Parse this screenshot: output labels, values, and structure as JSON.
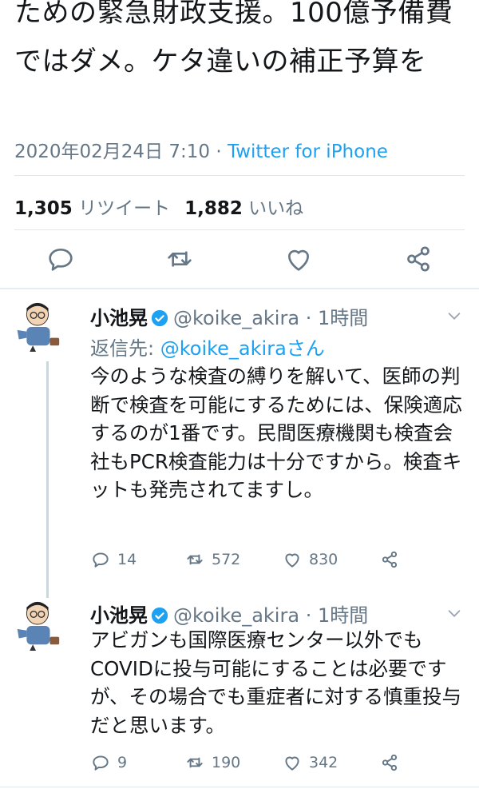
{
  "tweet": {
    "text": "ための緊急財政支援。100億予備費ではダメ。ケタ違いの補正予算を",
    "datetime": "2020年02月24日 7:10",
    "separator": " · ",
    "source": "Twitter for iPhone",
    "retweets": {
      "count": "1,305",
      "label": "リツイート"
    },
    "likes": {
      "count": "1,882",
      "label": "いいね"
    }
  },
  "replies": [
    {
      "name": "小池晃",
      "handle": "@koike_akira",
      "time": "· 1時間",
      "reply_prefix": "返信先: ",
      "reply_to": "@koike_akiraさん",
      "text": "今のような検査の縛りを解いて、医師の判断で検査を可能にするためには、保険適応するのが1番です。民間医療機関も検査会社もPCR検査能力は十分ですから。検査キットも発売されてますし。",
      "replies": "14",
      "retweets": "572",
      "likes": "830"
    },
    {
      "name": "小池晃",
      "handle": "@koike_akira",
      "time": "· 1時間",
      "text": "アビガンも国際医療センター以外でもCOVIDに投与可能にすることは必要ですが、その場合でも重症者に対する慎重投与だと思います。",
      "replies": "9",
      "retweets": "190",
      "likes": "342"
    }
  ],
  "colors": {
    "accent": "#1da1f2",
    "secondary_text": "#657786",
    "primary_text": "#14171a",
    "verified": "#1da1f2",
    "divider": "#e1e8ed"
  },
  "icons": [
    "reply-icon",
    "retweet-icon",
    "like-icon",
    "share-icon",
    "verified-icon",
    "chevron-down-icon"
  ]
}
